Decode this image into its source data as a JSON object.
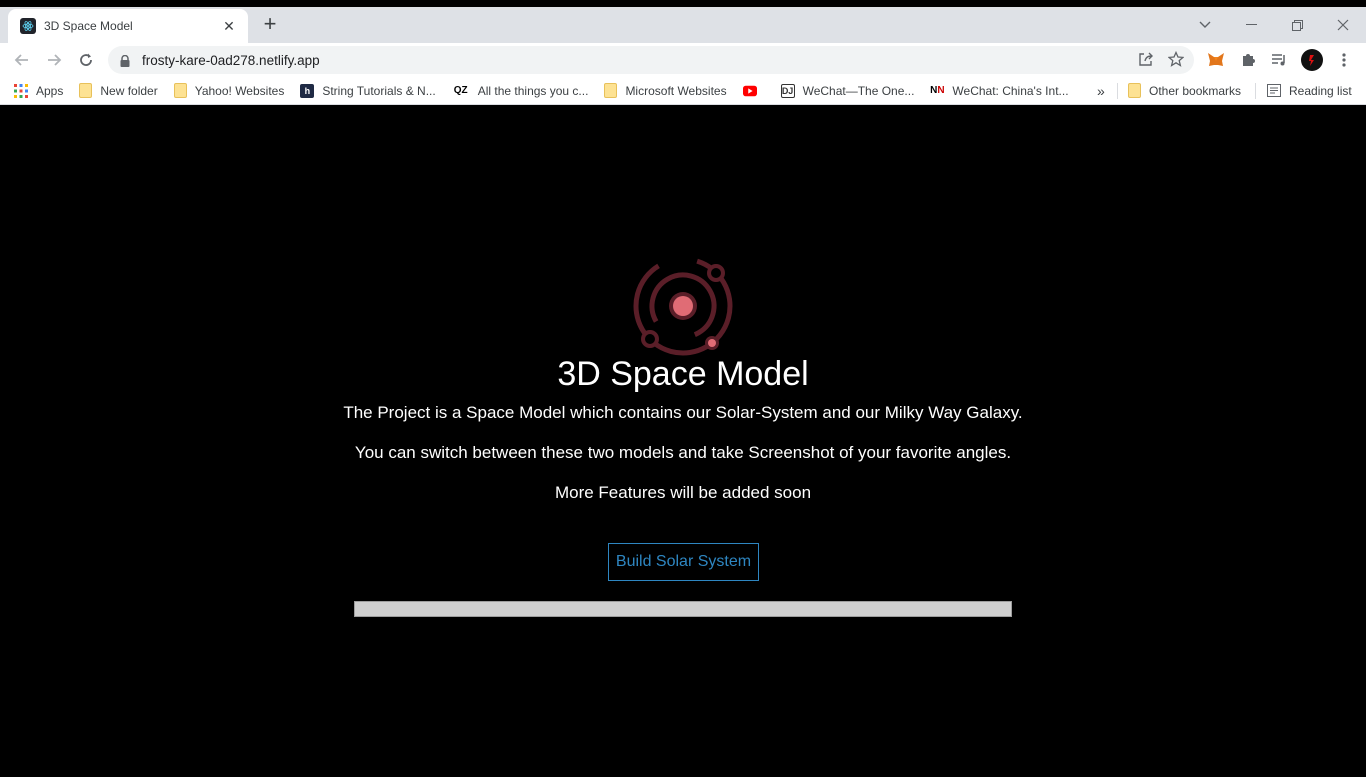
{
  "browser": {
    "tab": {
      "title": "3D Space Model"
    },
    "url": "frosty-kare-0ad278.netlify.app",
    "bookmarks": [
      {
        "label": "Apps",
        "icon": "apps-grid-icon"
      },
      {
        "label": "New folder",
        "icon": "folder-icon"
      },
      {
        "label": "Yahoo! Websites",
        "icon": "folder-icon"
      },
      {
        "label": "String Tutorials & N...",
        "icon": "h-icon"
      },
      {
        "label": "All the things you c...",
        "icon": "qz-icon"
      },
      {
        "label": "Microsoft Websites",
        "icon": "folder-icon"
      },
      {
        "label": "",
        "icon": "youtube-icon"
      },
      {
        "label": "WeChat—The One...",
        "icon": "dj-icon"
      },
      {
        "label": "WeChat: China's Int...",
        "icon": "nn-icon"
      }
    ],
    "more_bookmarks": "»",
    "other_bookmarks": "Other bookmarks",
    "reading_list": "Reading list"
  },
  "main": {
    "title": "3D Space Model",
    "lines": [
      "The Project is a Space Model which contains our Solar-System and our Milky Way Galaxy.",
      "You can switch between these two models and take Screenshot of your favorite angles.",
      "More Features will be added soon"
    ],
    "button_label": "Build Solar System",
    "progress": 0
  },
  "colors": {
    "accent": "#2e86c1",
    "logo_dark": "#5a1e28",
    "logo_light": "#e06c75"
  }
}
